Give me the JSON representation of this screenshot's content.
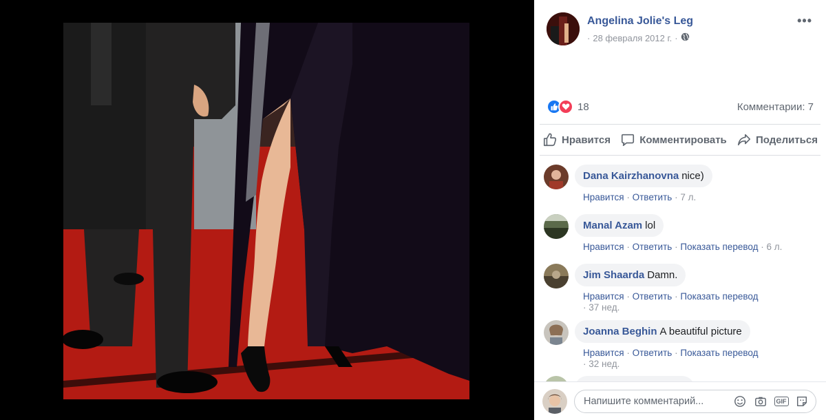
{
  "post": {
    "page_name": "Angelina Jolie's Leg",
    "date": "28 февраля 2012 г.",
    "separator": "·",
    "reaction_count": "18",
    "comments_summary": "Комментарии: 7",
    "icons": {
      "privacy": "globe-icon",
      "more": "more-icon",
      "like": "like-reaction-icon",
      "love": "love-reaction-icon"
    }
  },
  "actions": {
    "like": "Нравится",
    "comment": "Комментировать",
    "share": "Поделиться"
  },
  "comments": [
    {
      "author": "Dana Kairzhanovna",
      "text": "nice)",
      "like": "Нравится",
      "reply": "Ответить",
      "time": "7 л."
    },
    {
      "author": "Manal Azam",
      "text": "lol",
      "like": "Нравится",
      "reply": "Ответить",
      "translate": "Показать перевод",
      "time": "6 л."
    },
    {
      "author": "Jim Shaarda",
      "text": "Damn.",
      "like": "Нравится",
      "reply": "Ответить",
      "translate": "Показать перевод",
      "time": "37 нед."
    },
    {
      "author": "Joanna Beghin",
      "text": "A beautiful picture",
      "like": "Нравится",
      "reply": "Ответить",
      "translate": "Показать перевод",
      "time": "32 нед."
    }
  ],
  "composer": {
    "placeholder": "Напишите комментарий...",
    "gif_label": "GIF",
    "icons": [
      "emoji-icon",
      "camera-icon",
      "gif-icon",
      "sticker-icon"
    ]
  },
  "colors": {
    "link": "#385898",
    "meta": "#90949c",
    "like_blue": "#1877f2",
    "love_red": "#f33e58"
  }
}
